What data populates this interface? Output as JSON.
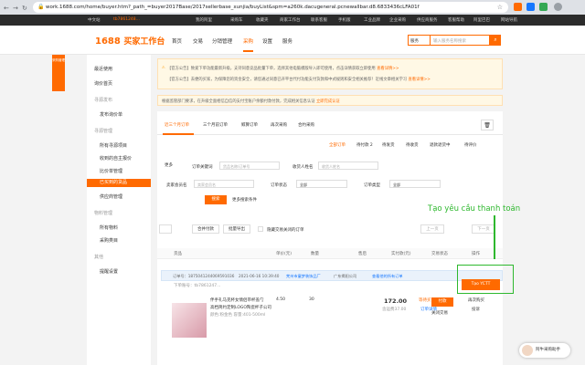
{
  "browser": {
    "url": "work.1688.com/home/buyer.htm?_path_=buyer2017Base/2017sellerbase_xunjia/buyList&spm=a260k.dacugeneral.pcnewallbar.d8.6833436cLFA01f",
    "back": "←",
    "forward": "→",
    "reload": "↻",
    "lock": "🔒",
    "star": "☆"
  },
  "topbar": {
    "left_label": "中文站",
    "user": "tb7861248...",
    "links": [
      "我的阿里",
      "采购车",
      "收藏夹",
      "商家工作台",
      "联系客服",
      "手机版",
      "工业品牌",
      "企业采购",
      "供应商服务",
      "客服帮助",
      "阿里巴巴",
      "网站导航"
    ]
  },
  "header": {
    "logo": "1688",
    "logo_sub": "买家工作台",
    "nav": [
      "首页",
      "交易",
      "分销管理",
      "采购",
      "设置",
      "服务"
    ],
    "active_nav": "采购",
    "search_select": "服务",
    "search_placeholder": "输入服务名称搜索",
    "search_icon": "search-icon"
  },
  "left_strip": "采购管理",
  "sidebar": {
    "items": [
      "最近使用",
      "询价首页",
      "寻源发布",
      "发布询价单",
      "寻源管理",
      "所有寻源项目",
      "收到的自主报价",
      "比价单管理",
      "已买到的货品",
      "供应商管理",
      "物料管理",
      "所有物料",
      "采购类目",
      "其他",
      "提醒设置"
    ],
    "active": "已买到的货品"
  },
  "notice": {
    "line1": "【官方公告】致爱下单功能最新升级，支持同意竞品批量下单，选择其他电脑模版导入即可使用，点击详情获取立即使用",
    "link1": "查看详情>>",
    "line2": "【官方公告】去便的买家，为保障您的资金安全，请您通过同意已开平台代付功能支付货款和中式规则和安全相关推荐！近线文章相关学习",
    "link2": "查看详情>>"
  },
  "warn": {
    "text": "根据监管部门要求，在升级全面相信自信的支付宝账户余额付款付款，完成相关信息认证",
    "link": "立即完成认证"
  },
  "tabs": [
    "近三个月订单",
    "三个月前订单",
    "鲸算订单",
    "再次采购",
    "合约采购"
  ],
  "status_filters": [
    "全部订单",
    "待付款 2",
    "待发货",
    "待收货",
    "退款退货中",
    "待评价"
  ],
  "filters": {
    "more": "更多",
    "keyword_label": "订单关键词",
    "keyword_ph": "货品名称/订单号",
    "seller_label": "收货人姓名",
    "seller_ph": "收货人姓名",
    "store_label": "卖家会员名",
    "store_ph": "卖家会员名",
    "status_label": "订单状态",
    "status_val": "全部",
    "type_label": "订单类型",
    "type_val": "全部",
    "search_btn": "搜索",
    "more_cond": "更多搜索条件"
  },
  "bulk": {
    "select_all": "全选",
    "merge_pay": "合并付款",
    "batch_export": "批量导出",
    "hide_closed": "隐藏交易关闭的订单",
    "prev": "上一页",
    "next": "下一页"
  },
  "grid_headers": [
    "货品",
    "单价(元)",
    "数量",
    "售后",
    "实付款(元)",
    "交易状态",
    "操作"
  ],
  "order": {
    "label": "订单号：1875041244069591036",
    "time": "2021-06-16 10:39:40",
    "shop": "梵州市童梦装饰品厂",
    "shop2": "广东揭阳公司",
    "view_all": "查看他的所有订单",
    "buyer": "下单账号：tb7861247...",
    "product_title": "伴手礼马克杯女情侣带杯盖勺",
    "product_desc": "高档简约定制LOGO陶瓷杯子公司",
    "product_sub": "颜色:粉金色 容量:401-500ml",
    "price": "4.50",
    "qty": "30",
    "total": "172.00",
    "shipping": "含运费37.00",
    "status": "等待买家付款",
    "detail": "订单详情",
    "pay": "付款",
    "rebuy": "再次购买",
    "close": "关闭交易",
    "report": "投诉"
  },
  "tycc": {
    "btn": "Tạo YCTT",
    "annotation": "Tạo yêu cầu thanh toán"
  },
  "assistant": {
    "label": "阿牛采购助手"
  }
}
